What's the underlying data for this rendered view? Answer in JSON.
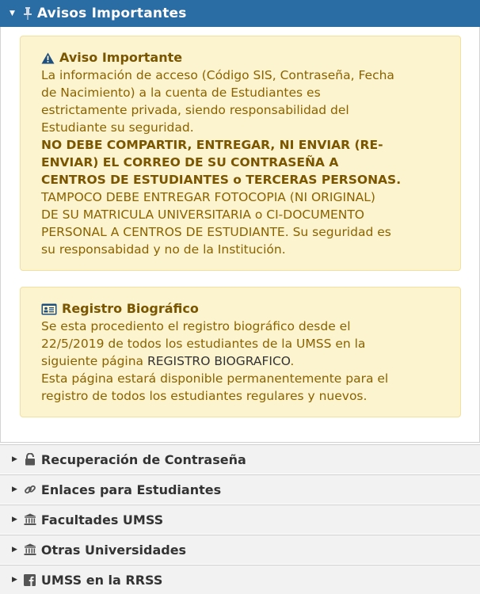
{
  "header": {
    "title": "Avisos Importantes",
    "caret_icon": "caret-down-icon",
    "pin_icon": "pin-icon",
    "bg_color": "#2a6ca4"
  },
  "aviso": {
    "icon": "warning-icon",
    "title": "Aviso Importante",
    "paragraph1_lines": [
      "La información de acceso (Código SIS, Contraseña, Fecha",
      "de Nacimiento) a la cuenta de Estudiantes es",
      "estrictamente privada, siendo responsabilidad del",
      "Estudiante su seguridad."
    ],
    "bold_lines": [
      "NO DEBE COMPARTIR, ENTREGAR, NI ENVIAR (RE-",
      "ENVIAR) EL CORREO DE SU CONTRASEÑA A",
      "CENTROS DE ESTUDIANTES o TERCERAS PERSONAS."
    ],
    "paragraph2_lines": [
      "TAMPOCO DEBE ENTREGAR FOTOCOPIA (NI ORIGINAL)",
      "DE SU MATRICULA UNIVERSITARIA o CI-DOCUMENTO",
      "PERSONAL A CENTROS DE ESTUDIANTE. Su seguridad es",
      "su responsabidad y no de la Institución."
    ]
  },
  "registro": {
    "icon": "id-card-icon",
    "title": "Registro Biográfico",
    "line1": "Se esta procediento el registro biográfico desde el",
    "line2": "22/5/2019 de todos los estudiantes de la UMSS en la",
    "line3_prefix": "siguiente página ",
    "link_text": "REGISTRO BIOGRAFICO",
    "line3_suffix": ".",
    "line4": "Esta página estará disponible permanentemente para el",
    "line5": "registro de todos los estudiantes regulares y nuevos."
  },
  "accordion": [
    {
      "label": "Recuperación de Contraseña",
      "icon": "unlock-icon"
    },
    {
      "label": "Enlaces para Estudiantes",
      "icon": "link-icon"
    },
    {
      "label": "Facultades UMSS",
      "icon": "institution-icon"
    },
    {
      "label": "Otras Universidades",
      "icon": "institution-icon"
    },
    {
      "label": "UMSS en la RRSS",
      "icon": "facebook-icon"
    }
  ]
}
